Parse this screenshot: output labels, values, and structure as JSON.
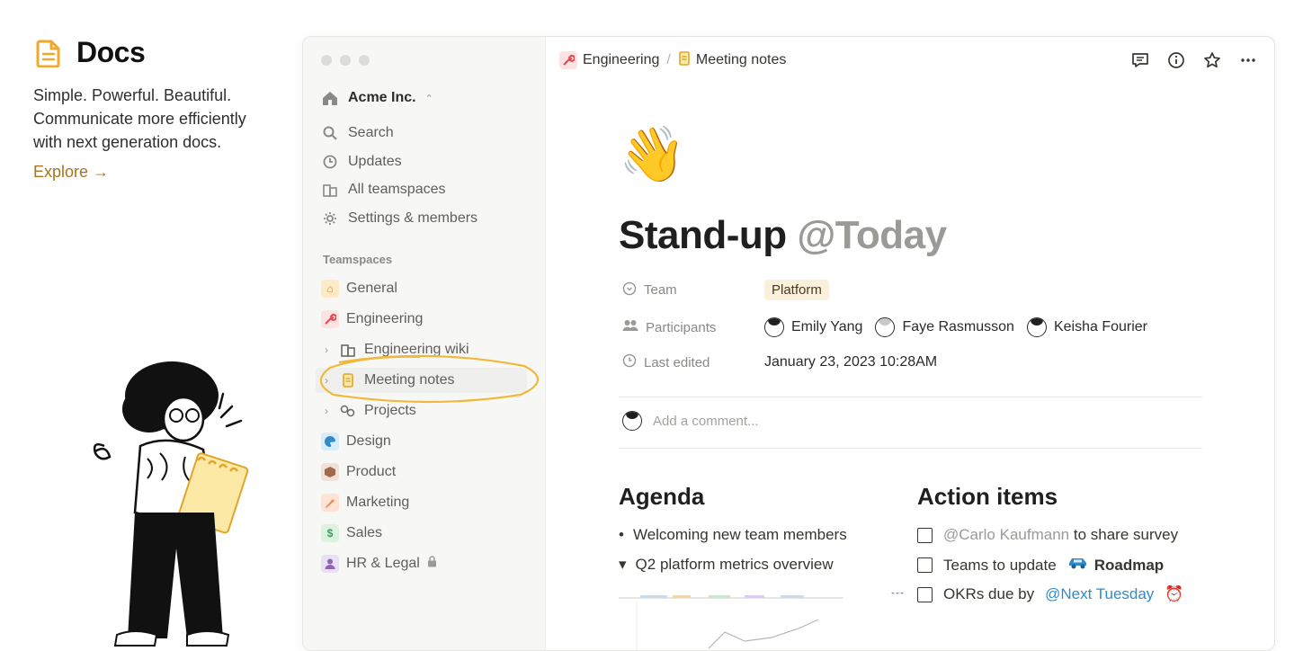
{
  "promo": {
    "title": "Docs",
    "desc_lines": [
      "Simple. Powerful. Beautiful.",
      "Communicate more efficiently",
      "with next generation docs."
    ],
    "explore": "Explore →"
  },
  "workspace": {
    "name": "Acme Inc.",
    "caret": "⌃"
  },
  "nav": {
    "search": "Search",
    "updates": "Updates",
    "all_teamspaces": "All teamspaces",
    "settings": "Settings & members"
  },
  "teamspaces": {
    "label": "Teamspaces",
    "items": [
      {
        "label": "General",
        "color": "#f5c26b"
      },
      {
        "label": "Engineering",
        "color": "#e5484d"
      },
      {
        "label": "Engineering wiki"
      },
      {
        "label": "Meeting notes"
      },
      {
        "label": "Projects"
      },
      {
        "label": "Design",
        "color": "#2f8bcc"
      },
      {
        "label": "Product",
        "color": "#a1684c"
      },
      {
        "label": "Marketing",
        "color": "#f08c5a"
      },
      {
        "label": "Sales",
        "glyph": "$",
        "color": "#3f9f5a"
      },
      {
        "label": "HR & Legal",
        "color": "#9065b0"
      }
    ]
  },
  "breadcrumb": {
    "first": "Engineering",
    "sep": "/",
    "second": "Meeting notes"
  },
  "page": {
    "emoji": "👋",
    "title": "Stand-up",
    "title_mention": "@Today",
    "props": {
      "team_key": "Team",
      "team_value": "Platform",
      "participants_key": "Participants",
      "participants": [
        "Emily Yang",
        "Faye Rasmusson",
        "Keisha Fourier"
      ],
      "edited_key": "Last edited",
      "edited_value": "January 23, 2023 10:28AM"
    },
    "comment_placeholder": "Add a comment...",
    "agenda": {
      "heading": "Agenda",
      "item1": "Welcoming new team members",
      "item2": "Q2 platform metrics overview",
      "bullet1": "•",
      "bullet2": "▾"
    },
    "actions": {
      "heading": "Action items",
      "todo1_mention": "@Carlo Kaufmann",
      "todo1_text": "to share survey",
      "todo2_text": "Teams to update",
      "todo2_link": "Roadmap",
      "todo3_text": "OKRs due by",
      "todo3_mention": "@Next Tuesday",
      "todo3_icon": "⏰"
    }
  }
}
